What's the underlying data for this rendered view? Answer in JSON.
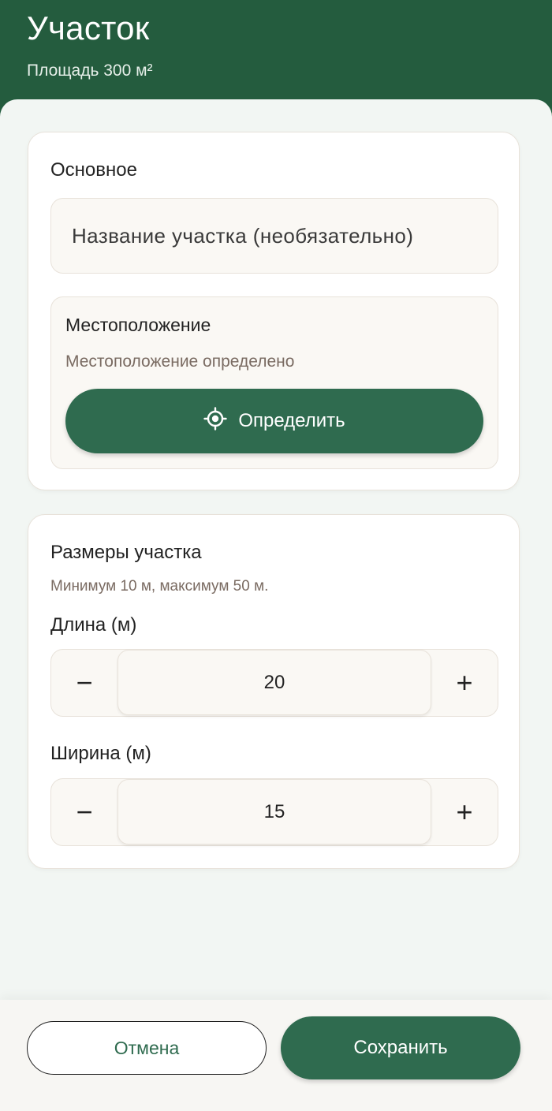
{
  "header": {
    "title": "Участок",
    "subtitle": "Площадь 300 м²"
  },
  "basic": {
    "title": "Основное",
    "name_placeholder": "Название участка (необязательно)",
    "location": {
      "title": "Местоположение",
      "status": "Местоположение определено",
      "button_label": "Определить",
      "button_icon": "crosshair-icon"
    }
  },
  "size": {
    "title": "Размеры участка",
    "hint": "Минимум 10 м, максимум 50 м.",
    "length": {
      "label": "Длина (м)",
      "value": "20",
      "minus": "−",
      "plus": "+"
    },
    "width": {
      "label": "Ширина (м)",
      "value": "15",
      "minus": "−",
      "plus": "+"
    }
  },
  "footer": {
    "cancel_label": "Отмена",
    "save_label": "Сохранить"
  },
  "colors": {
    "header_bg": "#245c3e",
    "primary": "#2f6b4f",
    "content_bg": "#f2f6f3"
  }
}
